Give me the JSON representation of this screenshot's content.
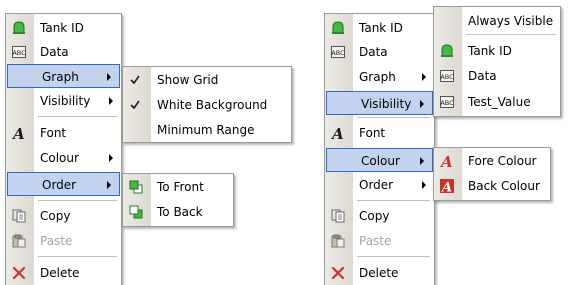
{
  "left_panel": {
    "main_menu": {
      "items": [
        {
          "label": "Tank ID",
          "icon": "tank-icon"
        },
        {
          "label": "Data",
          "icon": "abc-field-icon"
        },
        {
          "label": "Graph",
          "icon": "",
          "submenu": true,
          "highlighted": true
        },
        {
          "label": "Visibility",
          "icon": "",
          "submenu": true
        },
        {
          "label": "Font",
          "icon": "font-icon"
        },
        {
          "label": "Colour",
          "icon": "",
          "submenu": true
        },
        {
          "label": "Order",
          "icon": "",
          "submenu": true,
          "highlighted": true
        },
        {
          "label": "Copy",
          "icon": "copy-icon"
        },
        {
          "label": "Paste",
          "icon": "paste-icon",
          "disabled": true
        },
        {
          "label": "Delete",
          "icon": "delete-icon"
        }
      ]
    },
    "graph_submenu": {
      "items": [
        {
          "label": "Show Grid",
          "checked": true
        },
        {
          "label": "White Background",
          "checked": true
        },
        {
          "label": "Minimum Range",
          "checked": false
        }
      ]
    },
    "order_submenu": {
      "items": [
        {
          "label": "To Front",
          "icon": "bring-to-front-icon"
        },
        {
          "label": "To Back",
          "icon": "send-to-back-icon"
        }
      ]
    }
  },
  "right_panel": {
    "main_menu": {
      "items": [
        {
          "label": "Tank ID",
          "icon": "tank-icon"
        },
        {
          "label": "Data",
          "icon": "abc-field-icon"
        },
        {
          "label": "Graph",
          "icon": "",
          "submenu": true
        },
        {
          "label": "Visibility",
          "icon": "",
          "submenu": true,
          "highlighted": true
        },
        {
          "label": "Font",
          "icon": "font-icon"
        },
        {
          "label": "Colour",
          "icon": "",
          "submenu": true,
          "highlighted": true
        },
        {
          "label": "Order",
          "icon": "",
          "submenu": true
        },
        {
          "label": "Copy",
          "icon": "copy-icon"
        },
        {
          "label": "Paste",
          "icon": "paste-icon",
          "disabled": true
        },
        {
          "label": "Delete",
          "icon": "delete-icon"
        }
      ]
    },
    "visibility_submenu": {
      "items": [
        {
          "label": "Always Visible",
          "icon": ""
        },
        {
          "label": "Tank ID",
          "icon": "tank-icon"
        },
        {
          "label": "Data",
          "icon": "abc-field-icon"
        },
        {
          "label": "Test_Value",
          "icon": "abc-field-icon"
        }
      ]
    },
    "colour_submenu": {
      "items": [
        {
          "label": "Fore Colour",
          "icon": "fore-colour-icon"
        },
        {
          "label": "Back Colour",
          "icon": "back-colour-icon"
        }
      ]
    }
  },
  "colors": {
    "highlight_fill": "#c2d3ef",
    "highlight_border": "#316ac5",
    "tank_green": "#3fbf3f",
    "delete_red": "#d0302a",
    "font_icon": "#1a1a1a"
  },
  "icon_glyphs": {
    "abc": "ABC",
    "font": "A",
    "delete": "✕",
    "check": "✓"
  }
}
